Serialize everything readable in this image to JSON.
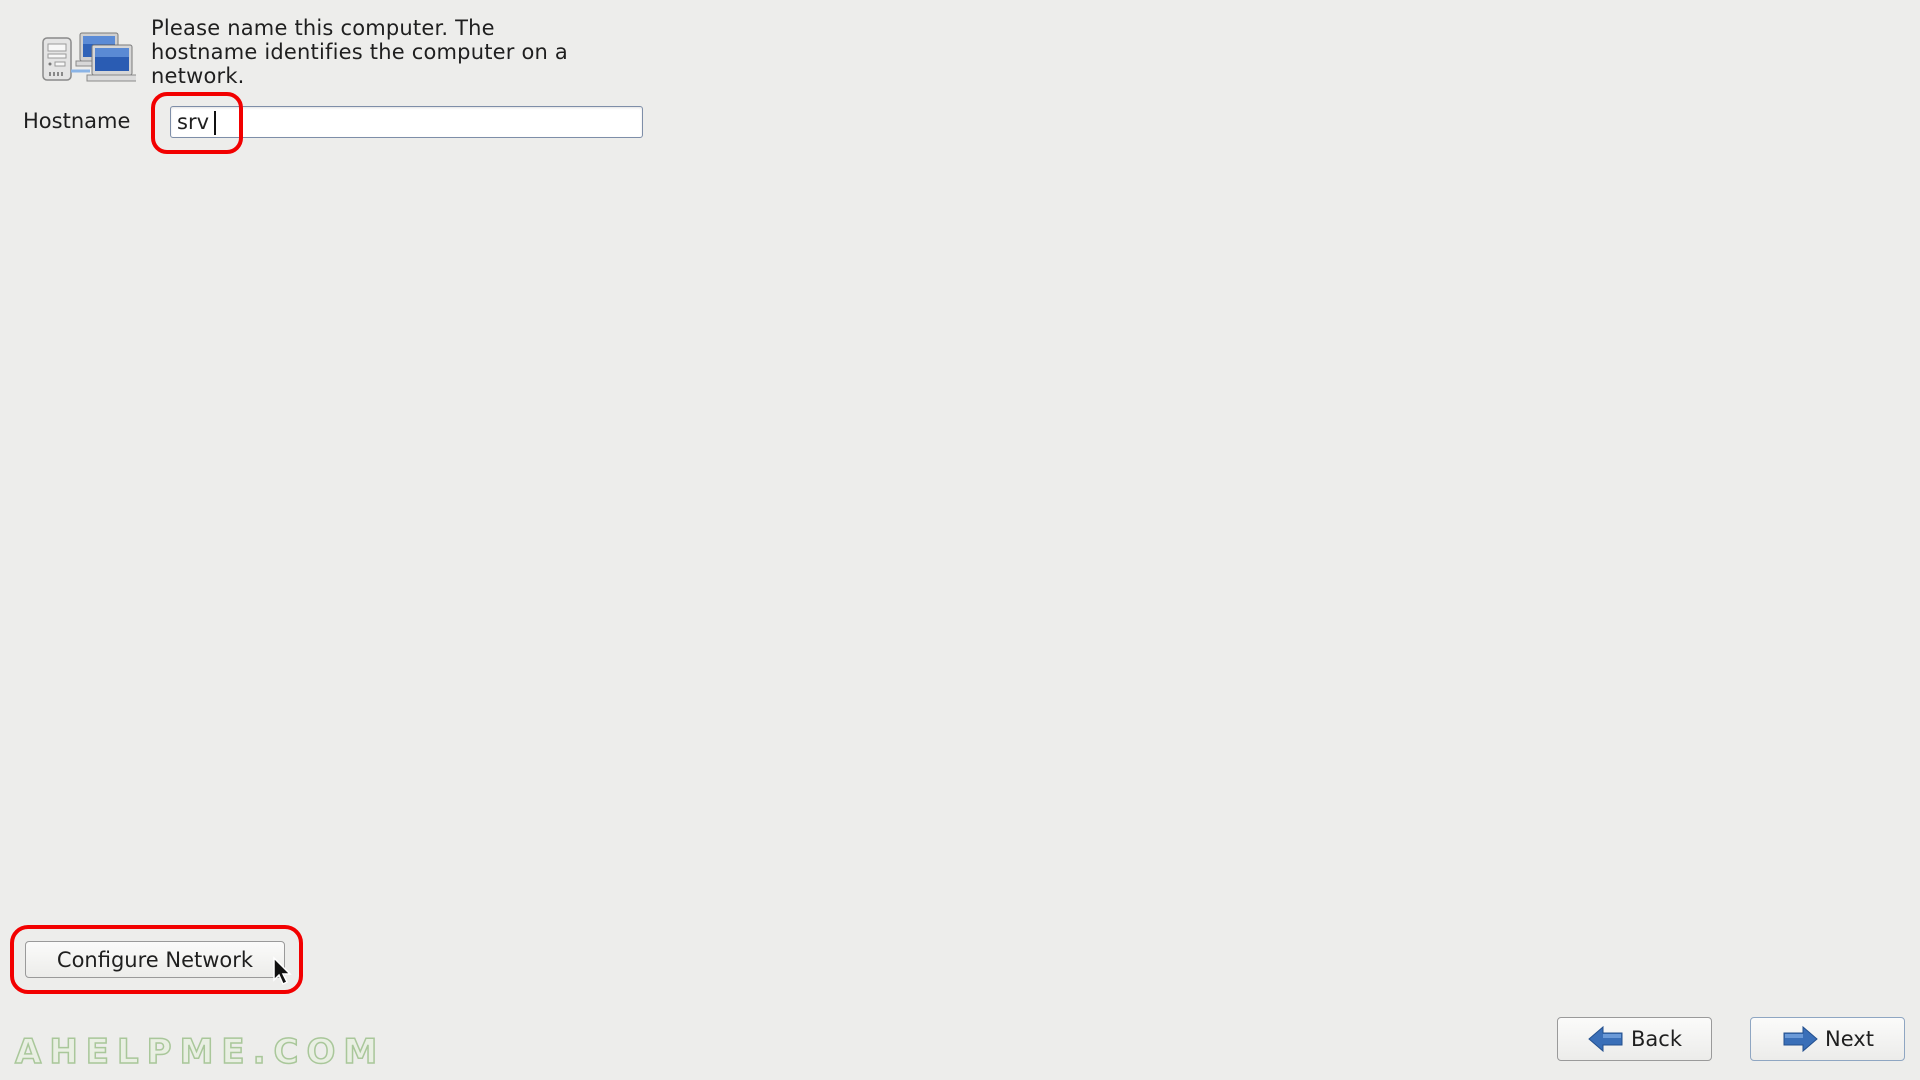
{
  "page": {
    "description": "Please name this computer.  The hostname identifies the computer on a network.",
    "description_lines": [
      "Please name this computer.  The",
      "hostname identifies the computer on a",
      "network."
    ],
    "icon": "network-computers-icon"
  },
  "hostname": {
    "label": "Hostname",
    "value": "srv"
  },
  "buttons": {
    "configure_network": "Configure Network",
    "back": "Back",
    "next": "Next"
  },
  "icons": {
    "back": "arrow-left-icon",
    "next": "arrow-right-icon",
    "cursor": "mouse-pointer-icon"
  },
  "annotations": {
    "highlight_color": "#f20000"
  },
  "watermark": "AHELPME.COM"
}
